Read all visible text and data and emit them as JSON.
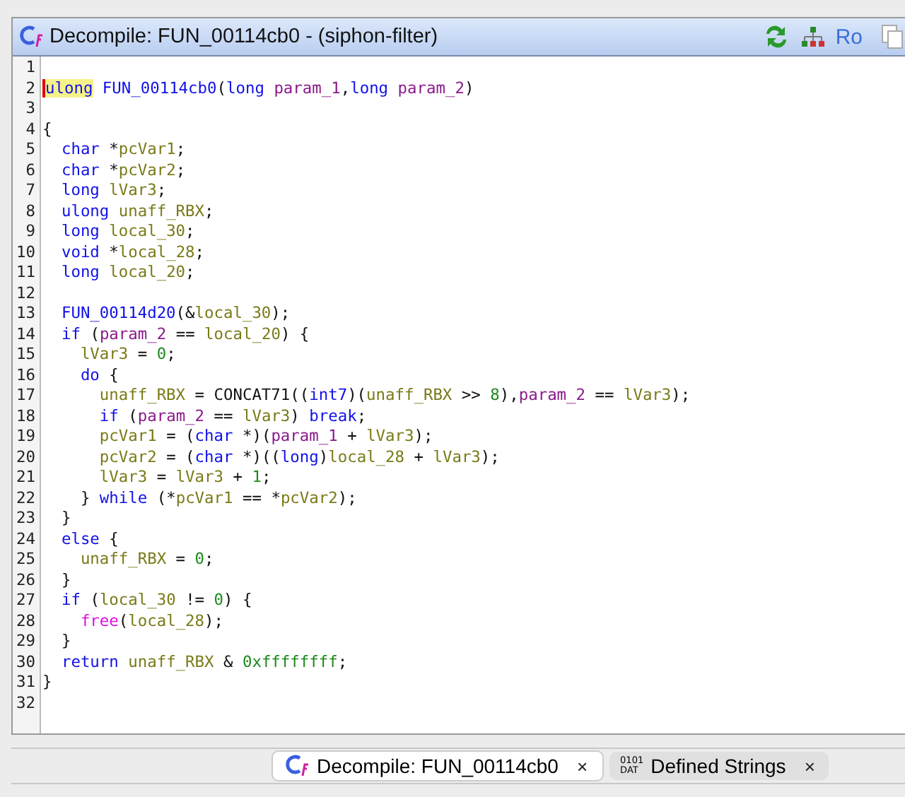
{
  "window": {
    "title": "Decompile: FUN_00114cb0 -  (siphon-filter)",
    "toolbar": [
      {
        "kind": "refresh"
      },
      {
        "kind": "graph"
      },
      {
        "kind": "text",
        "label": "Ro"
      },
      {
        "kind": "copy"
      }
    ]
  },
  "lines": [
    {
      "n": "1"
    },
    {
      "n": "2",
      "highlight": true,
      "tokens": [
        {
          "kind": "type",
          "text": "ulong"
        },
        {
          "kind": "func",
          "text": " FUN_00114cb0"
        },
        {
          "kind": "plain",
          "text": "("
        },
        {
          "kind": "type",
          "text": "long"
        },
        {
          "kind": "param",
          "text": " param_1"
        },
        {
          "kind": "plain",
          "text": ","
        },
        {
          "kind": "type",
          "text": "long"
        },
        {
          "kind": "param",
          "text": " param_2"
        },
        {
          "kind": "plain",
          "text": ")"
        }
      ]
    },
    {
      "n": "3"
    },
    {
      "n": "4",
      "tokens": [
        {
          "kind": "plain",
          "text": "{"
        }
      ]
    },
    {
      "n": "5",
      "tokens": [
        {
          "kind": "type",
          "text": "  char"
        },
        {
          "kind": "plain",
          "text": " *"
        },
        {
          "kind": "var",
          "text": "pcVar1"
        },
        {
          "kind": "plain",
          "text": ";"
        }
      ]
    },
    {
      "n": "6",
      "tokens": [
        {
          "kind": "type",
          "text": "  char"
        },
        {
          "kind": "plain",
          "text": " *"
        },
        {
          "kind": "var",
          "text": "pcVar2"
        },
        {
          "kind": "plain",
          "text": ";"
        }
      ]
    },
    {
      "n": "7",
      "tokens": [
        {
          "kind": "type",
          "text": "  long"
        },
        {
          "kind": "var",
          "text": " lVar3"
        },
        {
          "kind": "plain",
          "text": ";"
        }
      ]
    },
    {
      "n": "8",
      "tokens": [
        {
          "kind": "type",
          "text": "  ulong"
        },
        {
          "kind": "var",
          "text": " unaff_RBX"
        },
        {
          "kind": "plain",
          "text": ";"
        }
      ]
    },
    {
      "n": "9",
      "tokens": [
        {
          "kind": "type",
          "text": "  long"
        },
        {
          "kind": "var",
          "text": " local_30"
        },
        {
          "kind": "plain",
          "text": ";"
        }
      ]
    },
    {
      "n": "10",
      "tokens": [
        {
          "kind": "type",
          "text": "  void"
        },
        {
          "kind": "plain",
          "text": " *"
        },
        {
          "kind": "var",
          "text": "local_28"
        },
        {
          "kind": "plain",
          "text": ";"
        }
      ]
    },
    {
      "n": "11",
      "tokens": [
        {
          "kind": "type",
          "text": "  long"
        },
        {
          "kind": "var",
          "text": " local_20"
        },
        {
          "kind": "plain",
          "text": ";"
        }
      ]
    },
    {
      "n": "12"
    },
    {
      "n": "13",
      "tokens": [
        {
          "kind": "func",
          "text": "  FUN_00114d20"
        },
        {
          "kind": "plain",
          "text": "(&"
        },
        {
          "kind": "var",
          "text": "local_30"
        },
        {
          "kind": "plain",
          "text": ");"
        }
      ]
    },
    {
      "n": "14",
      "tokens": [
        {
          "kind": "keyword",
          "text": "  if"
        },
        {
          "kind": "plain",
          "text": " ("
        },
        {
          "kind": "param",
          "text": "param_2"
        },
        {
          "kind": "plain",
          "text": " =="
        },
        {
          "kind": "var",
          "text": " local_20"
        },
        {
          "kind": "plain",
          "text": ") {"
        }
      ]
    },
    {
      "n": "15",
      "tokens": [
        {
          "kind": "var",
          "text": "    lVar3"
        },
        {
          "kind": "plain",
          "text": " ="
        },
        {
          "kind": "num",
          "text": " 0"
        },
        {
          "kind": "plain",
          "text": ";"
        }
      ]
    },
    {
      "n": "16",
      "tokens": [
        {
          "kind": "keyword",
          "text": "    do"
        },
        {
          "kind": "plain",
          "text": " {"
        }
      ]
    },
    {
      "n": "17",
      "tokens": [
        {
          "kind": "var",
          "text": "      unaff_RBX"
        },
        {
          "kind": "plain",
          "text": " = CONCAT71(("
        },
        {
          "kind": "type",
          "text": "int7"
        },
        {
          "kind": "plain",
          "text": ")("
        },
        {
          "kind": "var",
          "text": "unaff_RBX"
        },
        {
          "kind": "plain",
          "text": " >>"
        },
        {
          "kind": "num",
          "text": " 8"
        },
        {
          "kind": "plain",
          "text": "),"
        },
        {
          "kind": "param",
          "text": "param_2"
        },
        {
          "kind": "plain",
          "text": " =="
        },
        {
          "kind": "var",
          "text": " lVar3"
        },
        {
          "kind": "plain",
          "text": ");"
        }
      ]
    },
    {
      "n": "18",
      "tokens": [
        {
          "kind": "keyword",
          "text": "      if"
        },
        {
          "kind": "plain",
          "text": " ("
        },
        {
          "kind": "param",
          "text": "param_2"
        },
        {
          "kind": "plain",
          "text": " =="
        },
        {
          "kind": "var",
          "text": " lVar3"
        },
        {
          "kind": "plain",
          "text": ")"
        },
        {
          "kind": "keyword",
          "text": " break"
        },
        {
          "kind": "plain",
          "text": ";"
        }
      ]
    },
    {
      "n": "19",
      "tokens": [
        {
          "kind": "var",
          "text": "      pcVar1"
        },
        {
          "kind": "plain",
          "text": " = ("
        },
        {
          "kind": "type",
          "text": "char"
        },
        {
          "kind": "plain",
          "text": " *)("
        },
        {
          "kind": "param",
          "text": "param_1"
        },
        {
          "kind": "plain",
          "text": " +"
        },
        {
          "kind": "var",
          "text": " lVar3"
        },
        {
          "kind": "plain",
          "text": ");"
        }
      ]
    },
    {
      "n": "20",
      "tokens": [
        {
          "kind": "var",
          "text": "      pcVar2"
        },
        {
          "kind": "plain",
          "text": " = ("
        },
        {
          "kind": "type",
          "text": "char"
        },
        {
          "kind": "plain",
          "text": " *)(("
        },
        {
          "kind": "type",
          "text": "long"
        },
        {
          "kind": "plain",
          "text": ")"
        },
        {
          "kind": "var",
          "text": "local_28"
        },
        {
          "kind": "plain",
          "text": " +"
        },
        {
          "kind": "var",
          "text": " lVar3"
        },
        {
          "kind": "plain",
          "text": ");"
        }
      ]
    },
    {
      "n": "21",
      "tokens": [
        {
          "kind": "var",
          "text": "      lVar3"
        },
        {
          "kind": "plain",
          "text": " ="
        },
        {
          "kind": "var",
          "text": " lVar3"
        },
        {
          "kind": "plain",
          "text": " +"
        },
        {
          "kind": "num",
          "text": " 1"
        },
        {
          "kind": "plain",
          "text": ";"
        }
      ]
    },
    {
      "n": "22",
      "tokens": [
        {
          "kind": "plain",
          "text": "    }"
        },
        {
          "kind": "keyword",
          "text": " while"
        },
        {
          "kind": "plain",
          "text": " (*"
        },
        {
          "kind": "var",
          "text": "pcVar1"
        },
        {
          "kind": "plain",
          "text": " == *"
        },
        {
          "kind": "var",
          "text": "pcVar2"
        },
        {
          "kind": "plain",
          "text": ");"
        }
      ]
    },
    {
      "n": "23",
      "tokens": [
        {
          "kind": "plain",
          "text": "  }"
        }
      ]
    },
    {
      "n": "24",
      "tokens": [
        {
          "kind": "keyword",
          "text": "  else"
        },
        {
          "kind": "plain",
          "text": " {"
        }
      ]
    },
    {
      "n": "25",
      "tokens": [
        {
          "kind": "var",
          "text": "    unaff_RBX"
        },
        {
          "kind": "plain",
          "text": " ="
        },
        {
          "kind": "num",
          "text": " 0"
        },
        {
          "kind": "plain",
          "text": ";"
        }
      ]
    },
    {
      "n": "26",
      "tokens": [
        {
          "kind": "plain",
          "text": "  }"
        }
      ]
    },
    {
      "n": "27",
      "tokens": [
        {
          "kind": "keyword",
          "text": "  if"
        },
        {
          "kind": "plain",
          "text": " ("
        },
        {
          "kind": "var",
          "text": "local_30"
        },
        {
          "kind": "plain",
          "text": " !="
        },
        {
          "kind": "num",
          "text": " 0"
        },
        {
          "kind": "plain",
          "text": ") {"
        }
      ]
    },
    {
      "n": "28",
      "tokens": [
        {
          "kind": "lib",
          "text": "    free"
        },
        {
          "kind": "plain",
          "text": "("
        },
        {
          "kind": "var",
          "text": "local_28"
        },
        {
          "kind": "plain",
          "text": ");"
        }
      ]
    },
    {
      "n": "29",
      "tokens": [
        {
          "kind": "plain",
          "text": "  }"
        }
      ]
    },
    {
      "n": "30",
      "tokens": [
        {
          "kind": "keyword",
          "text": "  return"
        },
        {
          "kind": "var",
          "text": " unaff_RBX"
        },
        {
          "kind": "plain",
          "text": " &"
        },
        {
          "kind": "num",
          "text": " 0xffffffff"
        },
        {
          "kind": "plain",
          "text": ";"
        }
      ]
    },
    {
      "n": "31",
      "tokens": [
        {
          "kind": "plain",
          "text": "}"
        }
      ]
    },
    {
      "n": "32"
    }
  ],
  "tabs": [
    {
      "kind": "decompile",
      "label": "Decompile: FUN_00114cb0",
      "close": "×",
      "selected": true
    },
    {
      "kind": "data",
      "icon_lines": [
        "0101",
        "DAT"
      ],
      "label": "Defined Strings",
      "close": "×",
      "selected": false
    }
  ]
}
